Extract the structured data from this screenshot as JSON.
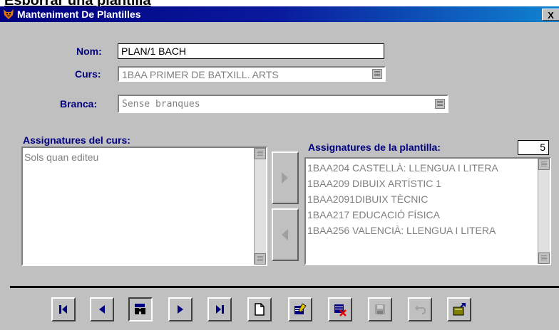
{
  "document": {
    "heading": "Esborrar una plantilla"
  },
  "window": {
    "title": "Manteniment De Plantilles",
    "close_label": "X"
  },
  "form": {
    "nom": {
      "label": "Nom:",
      "value": "PLAN/1 BACH"
    },
    "curs": {
      "label": "Curs:",
      "value": "1BAA PRIMER DE BATXILL. ARTS"
    },
    "branca": {
      "label": "Branca:",
      "value": "Sense branques"
    }
  },
  "course_subjects": {
    "label": "Assignatures del curs:",
    "items": [
      "Sols quan editeu"
    ]
  },
  "template_subjects": {
    "label": "Assignatures de la plantilla:",
    "count": "5",
    "items": [
      "1BAA204 CASTELLÀ: LLENGUA I LITERA",
      "1BAA209 DIBUIX ARTÍSTIC 1",
      "1BAA2091DIBUIX TÈCNIC",
      "1BAA217 EDUCACIÓ FÍSICA",
      "1BAA256 VALENCIÀ: LLENGUA I LITERA"
    ]
  },
  "move_buttons": {
    "add_icon": "arrow-right-icon",
    "remove_icon": "arrow-left-icon"
  },
  "toolbar": {
    "buttons": [
      "first-record",
      "previous-record",
      "find-record",
      "next-record",
      "last-record",
      "new-record",
      "edit-record",
      "delete-record",
      "save-record",
      "undo",
      "exit"
    ]
  },
  "colors": {
    "label_navy": "#000080",
    "face": "#c0c0c0",
    "title_from": "#000080",
    "title_to": "#1084d0"
  }
}
